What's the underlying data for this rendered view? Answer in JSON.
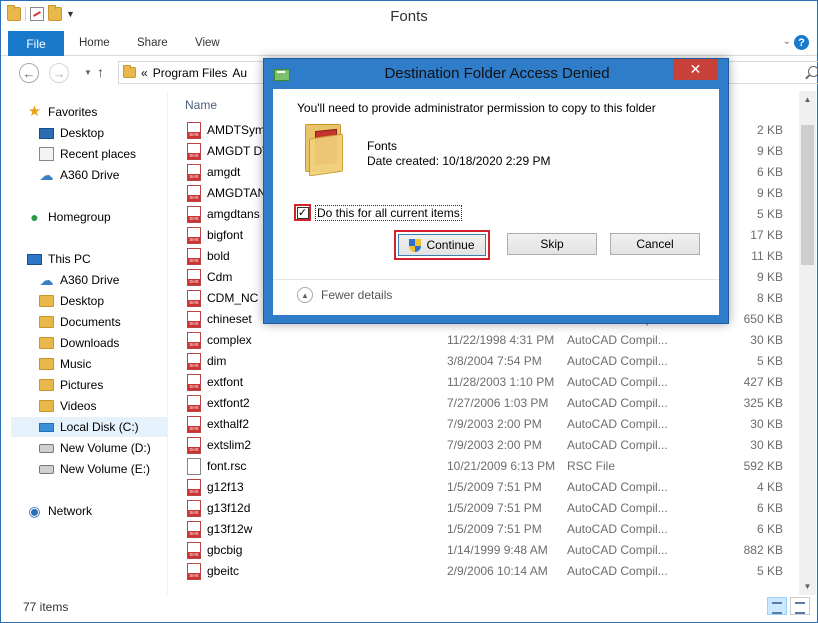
{
  "window": {
    "title": "Fonts"
  },
  "ribbon": {
    "file_tab": "File",
    "tabs": [
      "Home",
      "Share",
      "View"
    ]
  },
  "address": {
    "prefix": "«",
    "path": "Program Files",
    "truncated": "Au"
  },
  "navpane": {
    "items": [
      {
        "label": "Favorites",
        "icon": "star-icon"
      },
      {
        "label": "Desktop",
        "icon": "desktop-icon"
      },
      {
        "label": "Recent places",
        "icon": "recent-places-icon"
      },
      {
        "label": "A360 Drive",
        "icon": "cloud-icon"
      },
      {
        "label": "Homegroup",
        "icon": "homegroup-icon"
      },
      {
        "label": "This PC",
        "icon": "computer-icon"
      },
      {
        "label": "A360 Drive",
        "icon": "cloud-icon"
      },
      {
        "label": "Desktop",
        "icon": "folder-icon"
      },
      {
        "label": "Documents",
        "icon": "folder-icon"
      },
      {
        "label": "Downloads",
        "icon": "folder-icon"
      },
      {
        "label": "Music",
        "icon": "folder-icon"
      },
      {
        "label": "Pictures",
        "icon": "folder-icon"
      },
      {
        "label": "Videos",
        "icon": "folder-icon"
      },
      {
        "label": "Local Disk (C:)",
        "icon": "drive-icon"
      },
      {
        "label": "New Volume (D:)",
        "icon": "drive-icon"
      },
      {
        "label": "New Volume (E:)",
        "icon": "drive-icon"
      },
      {
        "label": "Network",
        "icon": "network-icon"
      }
    ]
  },
  "filelist": {
    "column_name": "Name",
    "rows": [
      {
        "name": "AMDTSym",
        "date": "",
        "type": "",
        "size": "2 KB"
      },
      {
        "name": "AMGDT DV",
        "date": "",
        "type": "",
        "size": "9 KB"
      },
      {
        "name": "amgdt",
        "date": "",
        "type": "",
        "size": "6 KB"
      },
      {
        "name": "AMGDTAN",
        "date": "",
        "type": "",
        "size": "9 KB"
      },
      {
        "name": "amgdtans",
        "date": "",
        "type": "",
        "size": "5 KB"
      },
      {
        "name": "bigfont",
        "date": "",
        "type": "",
        "size": "17 KB"
      },
      {
        "name": "bold",
        "date": "",
        "type": "",
        "size": "11 KB"
      },
      {
        "name": "Cdm",
        "date": "",
        "type": "",
        "size": "9 KB"
      },
      {
        "name": "CDM_NC",
        "date": "",
        "type": "",
        "size": "8 KB"
      },
      {
        "name": "chineset",
        "date": "11/19/1997 3:00 AM",
        "type": "AutoCAD Compil...",
        "size": "650 KB"
      },
      {
        "name": "complex",
        "date": "11/22/1998 4:31 PM",
        "type": "AutoCAD Compil...",
        "size": "30 KB"
      },
      {
        "name": "dim",
        "date": "3/8/2004 7:54 PM",
        "type": "AutoCAD Compil...",
        "size": "5 KB"
      },
      {
        "name": "extfont",
        "date": "11/28/2003 1:10 PM",
        "type": "AutoCAD Compil...",
        "size": "427 KB"
      },
      {
        "name": "extfont2",
        "date": "7/27/2006 1:03 PM",
        "type": "AutoCAD Compil...",
        "size": "325 KB"
      },
      {
        "name": "exthalf2",
        "date": "7/9/2003 2:00 PM",
        "type": "AutoCAD Compil...",
        "size": "30 KB"
      },
      {
        "name": "extslim2",
        "date": "7/9/2003 2:00 PM",
        "type": "AutoCAD Compil...",
        "size": "30 KB"
      },
      {
        "name": "font.rsc",
        "date": "10/21/2009 6:13 PM",
        "type": "RSC File",
        "size": "592 KB"
      },
      {
        "name": "g12f13",
        "date": "1/5/2009 7:51 PM",
        "type": "AutoCAD Compil...",
        "size": "4 KB"
      },
      {
        "name": "g13f12d",
        "date": "1/5/2009 7:51 PM",
        "type": "AutoCAD Compil...",
        "size": "6 KB"
      },
      {
        "name": "g13f12w",
        "date": "1/5/2009 7:51 PM",
        "type": "AutoCAD Compil...",
        "size": "6 KB"
      },
      {
        "name": "gbcbig",
        "date": "1/14/1999 9:48 AM",
        "type": "AutoCAD Compil...",
        "size": "882 KB"
      },
      {
        "name": "gbeitc",
        "date": "2/9/2006 10:14 AM",
        "type": "AutoCAD Compil...",
        "size": "5 KB"
      }
    ]
  },
  "status": {
    "items_count": "77 items"
  },
  "dialog": {
    "title": "Destination Folder Access Denied",
    "message": "You'll need to provide administrator permission to copy to this folder",
    "folder_name": "Fonts",
    "folder_date": "Date created: 10/18/2020 2:29 PM",
    "checkbox_label": "Do this for all current items",
    "checkbox_checked": true,
    "continue_label": "Continue",
    "skip_label": "Skip",
    "cancel_label": "Cancel",
    "fewer_details": "Fewer details",
    "highlight_color": "#d2232a"
  }
}
